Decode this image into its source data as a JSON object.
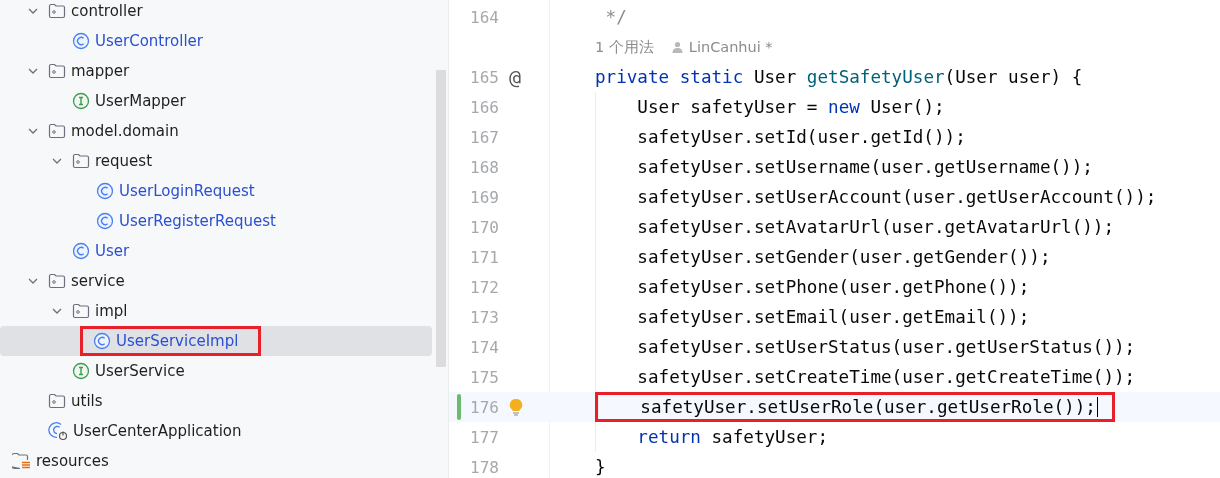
{
  "project_tree": {
    "items": [
      {
        "label": "controller",
        "kind": "folder",
        "expanded": true,
        "selected": false,
        "boxed": false,
        "children": [
          {
            "label": "UserController",
            "kind": "class",
            "selected": false,
            "boxed": false
          }
        ]
      },
      {
        "label": "mapper",
        "kind": "folder",
        "expanded": true,
        "selected": false,
        "boxed": false,
        "children": [
          {
            "label": "UserMapper",
            "kind": "interface",
            "selected": false,
            "boxed": false
          }
        ]
      },
      {
        "label": "model.domain",
        "kind": "folder",
        "expanded": true,
        "selected": false,
        "boxed": false,
        "children": [
          {
            "label": "request",
            "kind": "folder",
            "expanded": true,
            "selected": false,
            "boxed": false,
            "children": [
              {
                "label": "UserLoginRequest",
                "kind": "class",
                "selected": false,
                "boxed": false
              },
              {
                "label": "UserRegisterRequest",
                "kind": "class",
                "selected": false,
                "boxed": false
              }
            ]
          },
          {
            "label": "User",
            "kind": "class",
            "selected": false,
            "boxed": false
          }
        ]
      },
      {
        "label": "service",
        "kind": "folder",
        "expanded": true,
        "selected": false,
        "boxed": false,
        "children": [
          {
            "label": "impl",
            "kind": "folder",
            "expanded": true,
            "selected": false,
            "boxed": false,
            "children": [
              {
                "label": "UserServiceImpl",
                "kind": "class",
                "selected": true,
                "boxed": true
              }
            ]
          },
          {
            "label": "UserService",
            "kind": "interface",
            "selected": false,
            "boxed": false
          }
        ]
      },
      {
        "label": "utils",
        "kind": "folder",
        "selected": false,
        "boxed": false
      },
      {
        "label": "UserCenterApplication",
        "kind": "app",
        "selected": false,
        "boxed": false
      }
    ],
    "root_items": [
      {
        "label": "resources",
        "kind": "resources",
        "selected": false,
        "boxed": false
      }
    ]
  },
  "editor": {
    "lines": [
      {
        "kind": "code",
        "number": "164",
        "current": false,
        "boxed": false,
        "modified": false,
        "tokens": [
          {
            "t": " */",
            "kind": "comment"
          }
        ]
      },
      {
        "kind": "hint",
        "usages": "1 个用法",
        "author": "LinCanhui *"
      },
      {
        "kind": "code",
        "number": "165",
        "gutter": "@",
        "current": false,
        "boxed": false,
        "modified": false,
        "tokens": [
          {
            "t": "private static ",
            "kind": "keyword"
          },
          {
            "t": "User ",
            "kind": "plain"
          },
          {
            "t": "getSafetyUser",
            "kind": "method"
          },
          {
            "t": "(User user) {",
            "kind": "plain"
          }
        ]
      },
      {
        "kind": "code",
        "number": "166",
        "current": false,
        "boxed": false,
        "modified": false,
        "tokens": [
          {
            "t": "    User safetyUser = ",
            "kind": "plain"
          },
          {
            "t": "new ",
            "kind": "keyword"
          },
          {
            "t": "User();",
            "kind": "plain"
          }
        ]
      },
      {
        "kind": "code",
        "number": "167",
        "current": false,
        "boxed": false,
        "modified": false,
        "tokens": [
          {
            "t": "    safetyUser.setId(user.getId());",
            "kind": "plain"
          }
        ]
      },
      {
        "kind": "code",
        "number": "168",
        "current": false,
        "boxed": false,
        "modified": false,
        "tokens": [
          {
            "t": "    safetyUser.setUsername(user.getUsername());",
            "kind": "plain"
          }
        ]
      },
      {
        "kind": "code",
        "number": "169",
        "current": false,
        "boxed": false,
        "modified": false,
        "tokens": [
          {
            "t": "    safetyUser.setUserAccount(user.getUserAccount());",
            "kind": "plain"
          }
        ]
      },
      {
        "kind": "code",
        "number": "170",
        "current": false,
        "boxed": false,
        "modified": false,
        "tokens": [
          {
            "t": "    safetyUser.setAvatarUrl(user.getAvatarUrl());",
            "kind": "plain"
          }
        ]
      },
      {
        "kind": "code",
        "number": "171",
        "current": false,
        "boxed": false,
        "modified": false,
        "tokens": [
          {
            "t": "    safetyUser.setGender(user.getGender());",
            "kind": "plain"
          }
        ]
      },
      {
        "kind": "code",
        "number": "172",
        "current": false,
        "boxed": false,
        "modified": false,
        "tokens": [
          {
            "t": "    safetyUser.setPhone(user.getPhone());",
            "kind": "plain"
          }
        ]
      },
      {
        "kind": "code",
        "number": "173",
        "current": false,
        "boxed": false,
        "modified": false,
        "tokens": [
          {
            "t": "    safetyUser.setEmail(user.getEmail());",
            "kind": "plain"
          }
        ]
      },
      {
        "kind": "code",
        "number": "174",
        "current": false,
        "boxed": false,
        "modified": false,
        "tokens": [
          {
            "t": "    safetyUser.setUserStatus(user.getUserStatus());",
            "kind": "plain"
          }
        ]
      },
      {
        "kind": "code",
        "number": "175",
        "current": false,
        "boxed": false,
        "modified": false,
        "tokens": [
          {
            "t": "    safetyUser.setCreateTime(user.getCreateTime());",
            "kind": "plain"
          }
        ]
      },
      {
        "kind": "code",
        "number": "176",
        "current": true,
        "boxed": true,
        "modified": true,
        "bulb": true,
        "tokens": [
          {
            "t": "    safetyUser.setUserRole(user.getUserRole());",
            "kind": "plain"
          }
        ]
      },
      {
        "kind": "code",
        "number": "177",
        "current": false,
        "boxed": false,
        "modified": false,
        "tokens": [
          {
            "t": "    return ",
            "kind": "keyword"
          },
          {
            "t": "safetyUser;",
            "kind": "plain"
          }
        ]
      },
      {
        "kind": "code",
        "number": "178",
        "current": false,
        "boxed": false,
        "modified": false,
        "tokens": [
          {
            "t": "}",
            "kind": "plain"
          }
        ]
      }
    ]
  }
}
